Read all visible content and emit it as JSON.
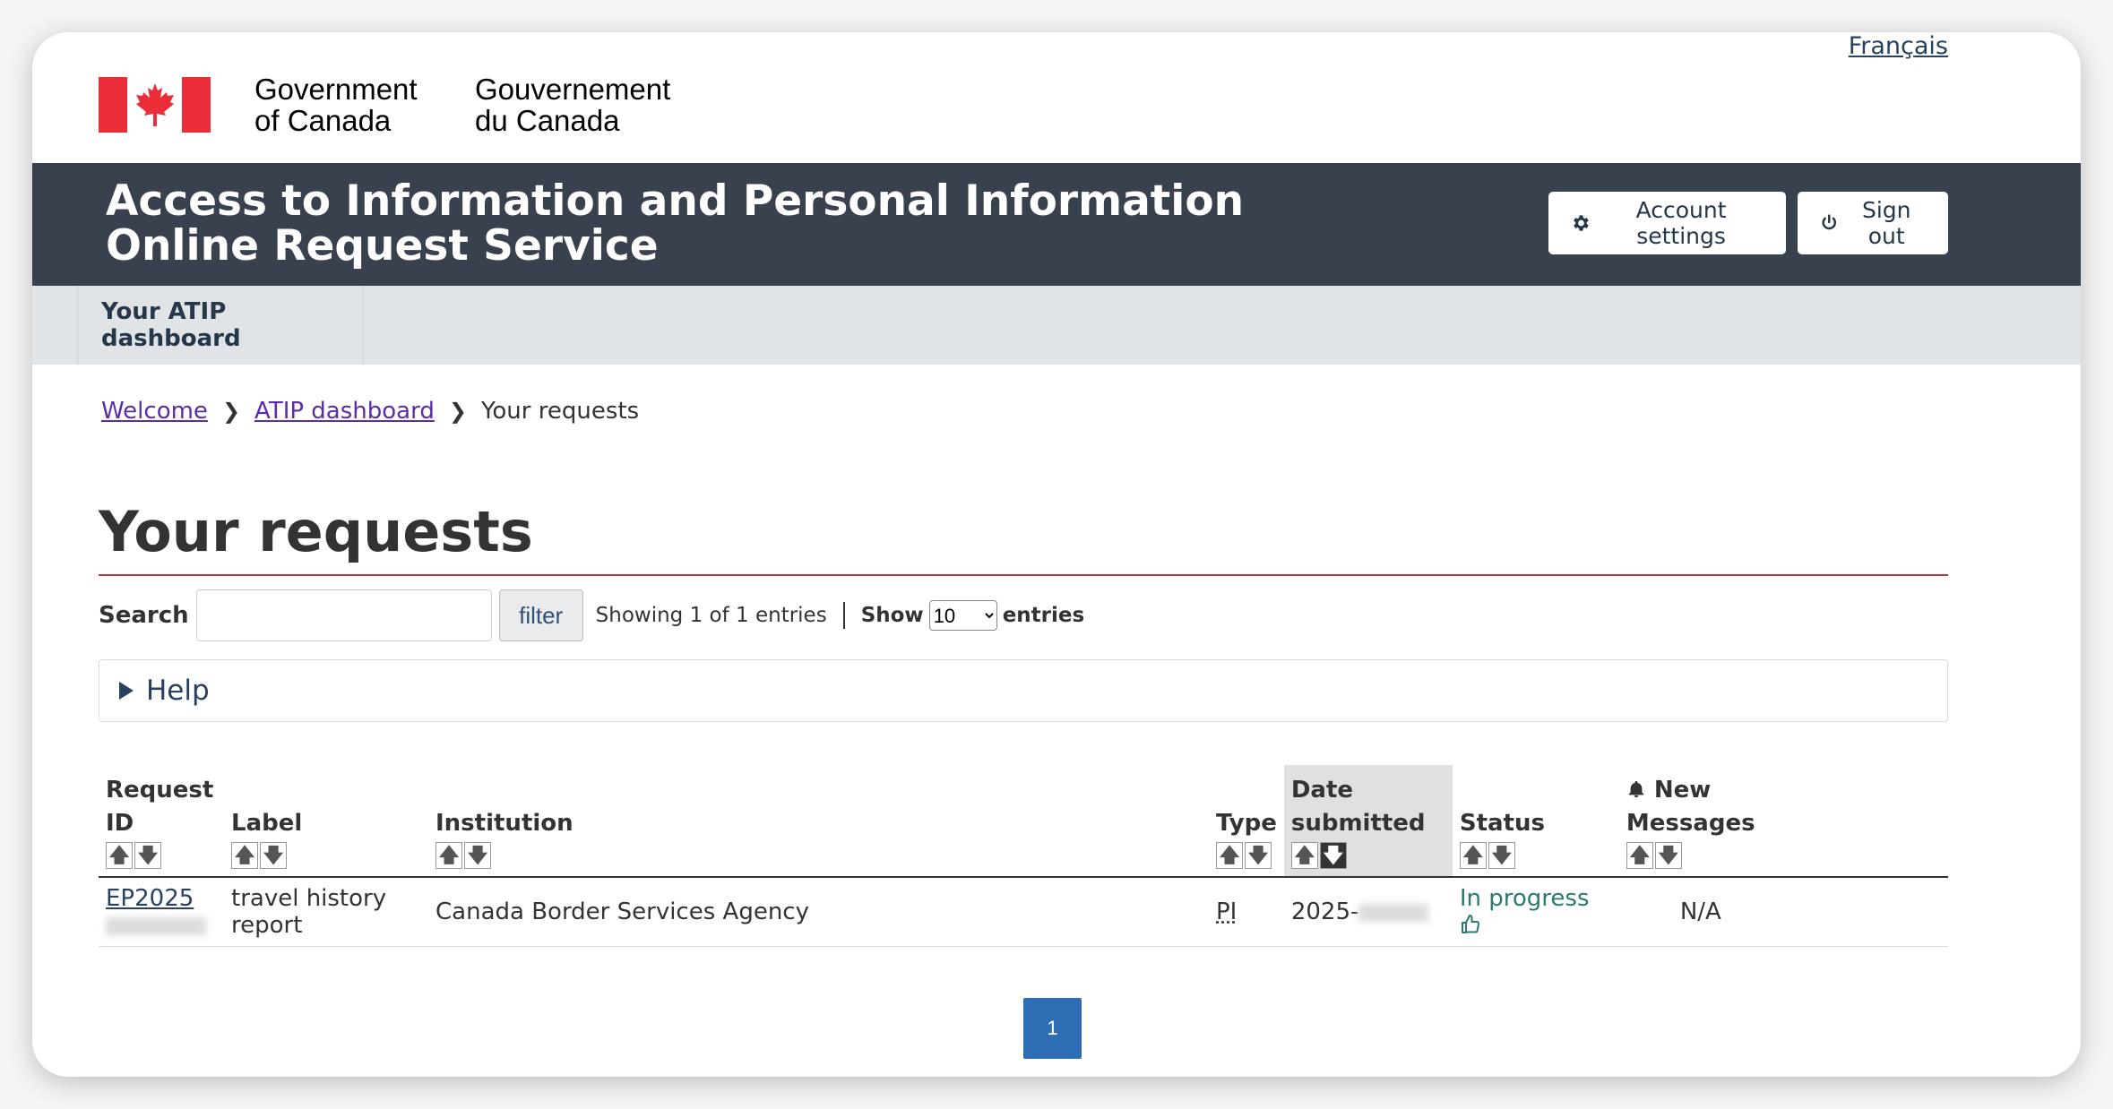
{
  "header": {
    "language_link": "Français",
    "gov_en_line1": "Government",
    "gov_en_line2": "of Canada",
    "gov_fr_line1": "Gouvernement",
    "gov_fr_line2": "du Canada"
  },
  "appbar": {
    "title_line1": "Access to Information and Personal Information",
    "title_line2": "Online Request Service",
    "account_settings_label": "Account settings",
    "sign_out_label": "Sign out"
  },
  "subnav": {
    "dashboard_label": "Your ATIP dashboard"
  },
  "breadcrumb": {
    "items": [
      "Welcome",
      "ATIP dashboard"
    ],
    "current": "Your requests"
  },
  "page": {
    "title": "Your requests"
  },
  "controls": {
    "search_label": "Search",
    "search_value": "",
    "filter_label": "filter",
    "showing_text": "Showing 1 of 1 entries",
    "show_label": "Show",
    "entries_selected": "10",
    "entries_label": "entries"
  },
  "help": {
    "label": "Help"
  },
  "table": {
    "columns": {
      "request_id": "Request ID",
      "label": "Label",
      "institution": "Institution",
      "type": "Type",
      "date_line1": "Date",
      "date_line2": "submitted",
      "status": "Status",
      "messages_line1": "New",
      "messages_line2": "Messages"
    },
    "rows": [
      {
        "request_id_visible": "EP2025",
        "label": "travel history report",
        "institution": "Canada Border Services Agency",
        "type": "PI",
        "date_visible": "2025-",
        "status": "In progress",
        "new_messages": "N/A"
      }
    ],
    "sorted_column": "date_submitted",
    "sort_direction": "descending"
  },
  "pagination": {
    "current_page": "1"
  },
  "colors": {
    "flag_red": "#eb2d37",
    "appbar_bg": "#38414d",
    "subnav_bg": "#e1e4e7",
    "title_rule": "#af3c43",
    "visited_link": "#5b2da8",
    "status_green": "#2b7b6e",
    "pager_blue": "#2e6db4"
  },
  "icons": [
    "canada-flag-icon",
    "gear-icon",
    "power-icon",
    "chevron-right-icon",
    "triangle-right-icon",
    "sort-up-icon",
    "sort-down-icon",
    "thumbs-up-icon",
    "bell-icon",
    "chevron-down-icon"
  ]
}
